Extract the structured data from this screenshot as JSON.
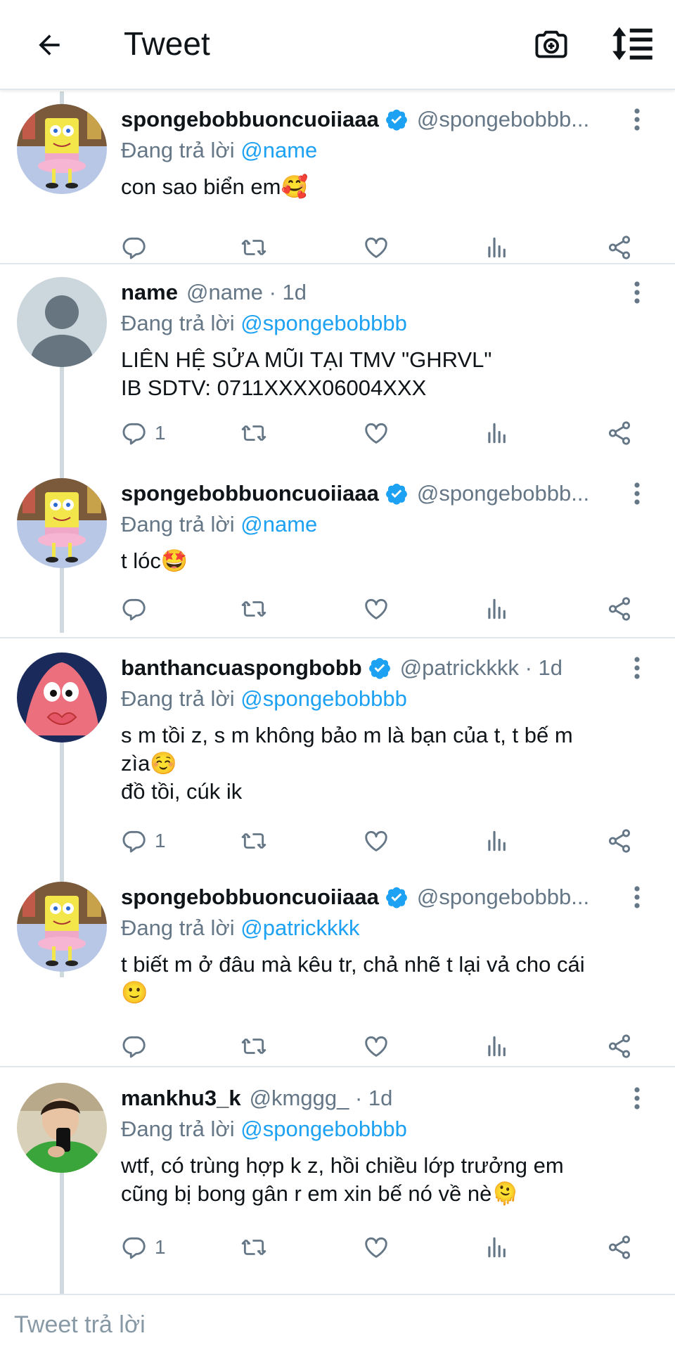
{
  "header": {
    "title": "Tweet",
    "back_icon": "arrow-left-icon",
    "camera_icon": "camera-plus-icon",
    "sort_icon": "sort-icon"
  },
  "colors": {
    "accent": "#1da1f2",
    "secondary_text": "#657786",
    "divider": "#e1e8ed",
    "thread_line": "#cfd9de"
  },
  "replying_prefix": "Đang trả lời",
  "tweets": [
    {
      "name": "spongebobbuoncuoiiaaa",
      "verified": true,
      "handle": "@spongebobbb...",
      "replying_to": "@name",
      "text": "con sao biển em🥰",
      "reply_count": "",
      "avatar": "spongebob"
    },
    {
      "name": "name",
      "verified": false,
      "handle": "@name · 1d",
      "replying_to": "@spongebobbbb",
      "text": "LIÊN HỆ SỬA MŨI TẠI TMV \"GHRVL\"\nIB SDTV: 0711XXXX06004XXX",
      "reply_count": "1",
      "avatar": "default"
    },
    {
      "name": "spongebobbuoncuoiiaaa",
      "verified": true,
      "handle": "@spongebobbb...",
      "replying_to": "@name",
      "text": "t lóc🤩",
      "reply_count": "",
      "avatar": "spongebob"
    },
    {
      "name": "banthancuaspongbobb",
      "verified": true,
      "handle": "@patrickkkk · 1d",
      "replying_to": "@spongebobbbb",
      "text": "s m tồi z, s m không bảo m là bạn của t, t bế m\nzìa☺️\nđồ tồi, cúk ik",
      "reply_count": "1",
      "avatar": "patrick"
    },
    {
      "name": "spongebobbuoncuoiiaaa",
      "verified": true,
      "handle": "@spongebobbb...",
      "replying_to": "@patrickkkk",
      "text": "t biết m ở đâu mà kêu tr, chả nhẽ t lại vả cho cái\n🙂",
      "reply_count": "",
      "avatar": "spongebob"
    },
    {
      "name": "mankhu3_k",
      "verified": false,
      "handle": "@kmggg_ · 1d",
      "replying_to": "@spongebobbbb",
      "text": "wtf, có trùng hợp k z, hồi chiều lớp trưởng em\ncũng bị bong gân r em xin bế nó về nè🫠",
      "reply_count": "1",
      "avatar": "person"
    }
  ],
  "composer": {
    "placeholder": "Tweet trả lời"
  }
}
